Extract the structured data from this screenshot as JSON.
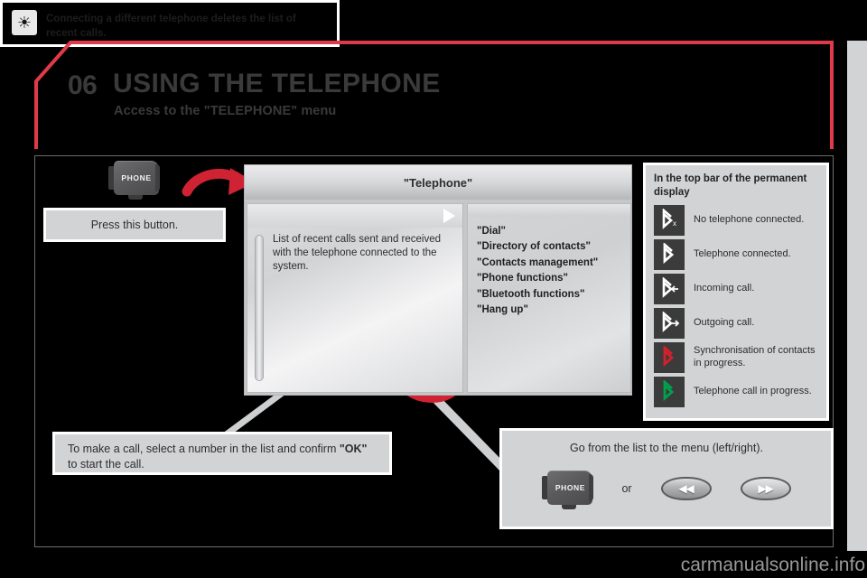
{
  "chapter": {
    "number": "06",
    "title": "USING THE TELEPHONE",
    "subtitle": "Access to the \"TELEPHONE\" menu"
  },
  "left": {
    "phone_button_label": "PHONE",
    "press_note": "Press this button.",
    "ok_note_part1": "To make a call, select a number in the list and confirm ",
    "ok_note_bold": "\"OK\"",
    "ok_note_part2": " to start the call.",
    "tip_icon": "tip-bulb-icon",
    "tip_text": "Connecting a different telephone deletes the list of recent calls."
  },
  "screen": {
    "title": "\"Telephone\"",
    "list_text": "List of recent calls sent and received with the telephone connected to the system.",
    "menu_items": [
      "\"Dial\"",
      "\"Directory of contacts\"",
      "\"Contacts management\"",
      "\"Phone functions\"",
      "\"Bluetooth functions\"",
      "\"Hang up\""
    ]
  },
  "bluetooth_legend": {
    "heading": "In the top bar of the permanent display",
    "rows": [
      {
        "icon": "bluetooth-disconnected-icon",
        "label": "No telephone connected.",
        "color": "#ffffff",
        "mark": "x"
      },
      {
        "icon": "bluetooth-connected-icon",
        "label": "Telephone connected.",
        "color": "#ffffff",
        "mark": ""
      },
      {
        "icon": "bluetooth-incoming-call-icon",
        "label": "Incoming call.",
        "color": "#ffffff",
        "mark": "left"
      },
      {
        "icon": "bluetooth-outgoing-call-icon",
        "label": "Outgoing call.",
        "color": "#ffffff",
        "mark": "right"
      },
      {
        "icon": "bluetooth-sync-icon",
        "label": "Synchronisation of contacts in progress.",
        "color": "#d5202a",
        "mark": ""
      },
      {
        "icon": "bluetooth-call-active-icon",
        "label": "Telephone call in progress.",
        "color": "#00a14b",
        "mark": ""
      }
    ]
  },
  "nav_panel": {
    "title": "Go from the list to the menu (left/right).",
    "phone_button_label": "PHONE",
    "or_label": "or",
    "rewind_glyph": "◀◀",
    "forward_glyph": "▶▶"
  },
  "watermark": "carmanualsonline.info",
  "colors": {
    "accent_red": "#e03a48",
    "arrow_red": "#cf2233",
    "box_grey": "#d2d3d5",
    "text_dark": "#2d2d2d"
  }
}
